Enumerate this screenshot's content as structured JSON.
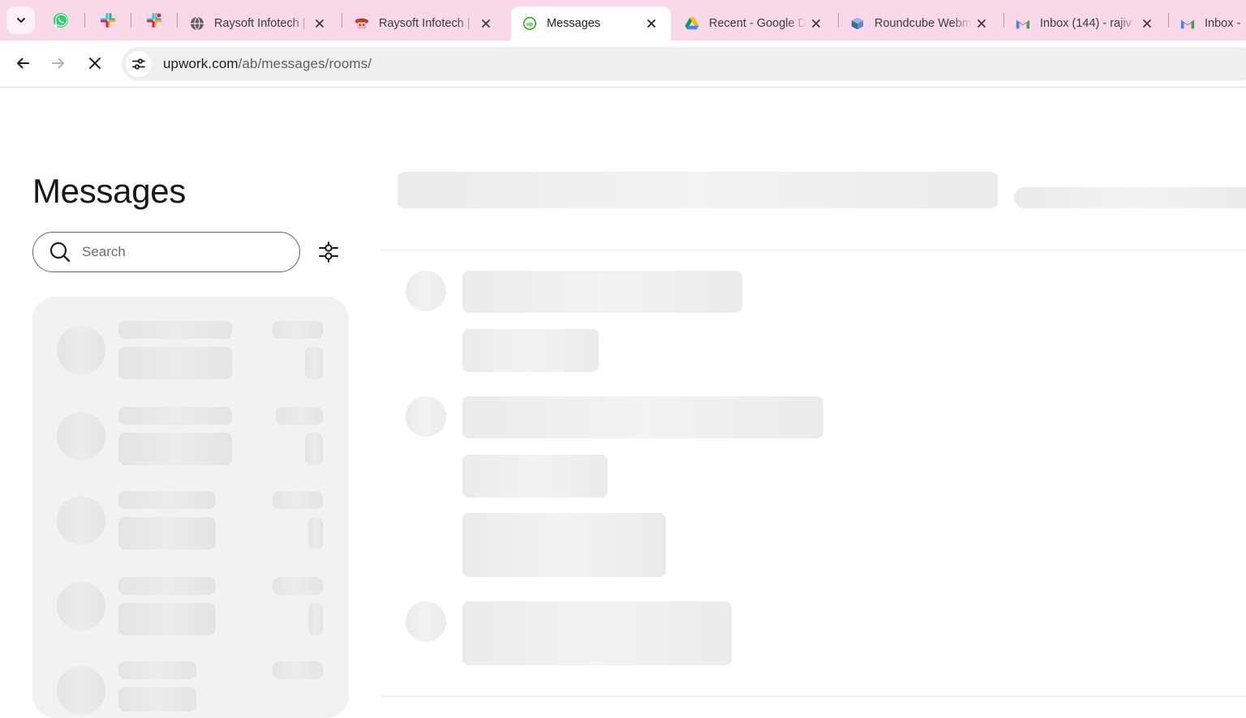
{
  "browser": {
    "tabs": [
      {
        "title": "Raysoft Infotech | ",
        "active": false,
        "icon": "globe-icon"
      },
      {
        "title": "Raysoft Infotech | ",
        "active": false,
        "icon": "raysoft-icon"
      },
      {
        "title": "Messages",
        "active": true,
        "icon": "upwork-icon"
      },
      {
        "title": "Recent - Google D",
        "active": false,
        "icon": "google-drive-icon"
      },
      {
        "title": "Roundcube Webm",
        "active": false,
        "icon": "roundcube-icon"
      },
      {
        "title": "Inbox (144) - rajiv",
        "active": false,
        "icon": "gmail-icon"
      },
      {
        "title": "Inbox - ",
        "active": false,
        "icon": "gmail-icon"
      }
    ],
    "pinned_tabs": [
      "whatsapp-icon",
      "slack-icon",
      "slack-icon"
    ],
    "address": {
      "host": "upwork.com",
      "path": "/ab/messages/rooms/"
    },
    "colors": {
      "tabstrip": "#f9d9e9",
      "omnibox": "#efefef"
    }
  },
  "page": {
    "title": "Messages",
    "search": {
      "placeholder": "Search",
      "value": ""
    },
    "state": "loading"
  }
}
